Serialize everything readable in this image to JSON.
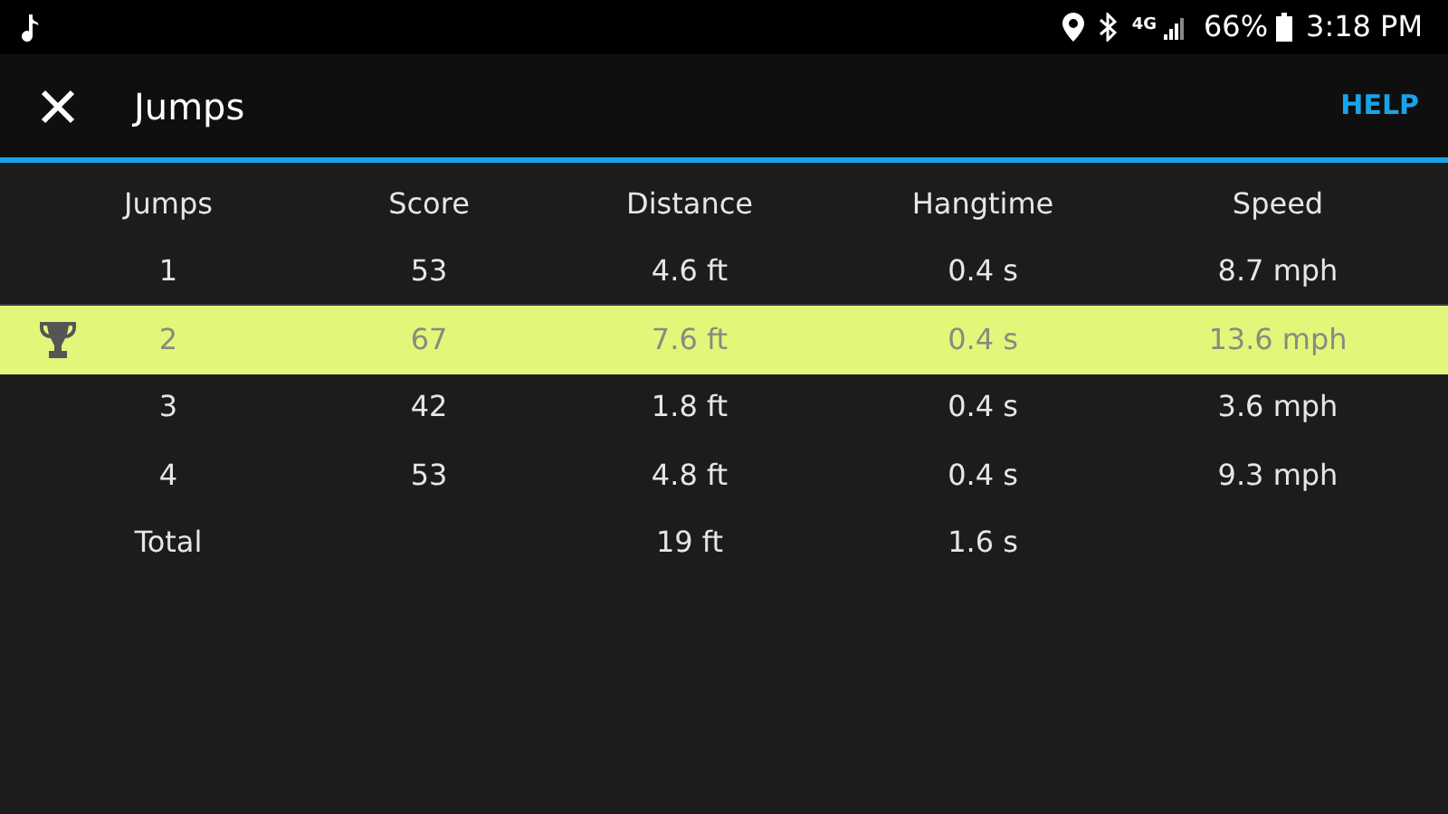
{
  "status_bar": {
    "network": "4G",
    "battery": "66%",
    "time": "3:18 PM"
  },
  "app_bar": {
    "title": "Jumps",
    "action": "HELP"
  },
  "table": {
    "columns": [
      "Jumps",
      "Score",
      "Distance",
      "Hangtime",
      "Speed"
    ],
    "rows": [
      {
        "cells": [
          "1",
          "53",
          "4.6 ft",
          "0.4 s",
          "8.7 mph"
        ],
        "selected": false,
        "best": false
      },
      {
        "cells": [
          "2",
          "67",
          "7.6 ft",
          "0.4 s",
          "13.6 mph"
        ],
        "selected": true,
        "best": true
      },
      {
        "cells": [
          "3",
          "42",
          "1.8 ft",
          "0.4 s",
          "3.6 mph"
        ],
        "selected": false,
        "best": false
      },
      {
        "cells": [
          "4",
          "53",
          "4.8 ft",
          "0.4 s",
          "9.3 mph"
        ],
        "selected": false,
        "best": false
      }
    ],
    "total": {
      "label": "Total",
      "distance": "19 ft",
      "hangtime": "1.6 s"
    }
  }
}
